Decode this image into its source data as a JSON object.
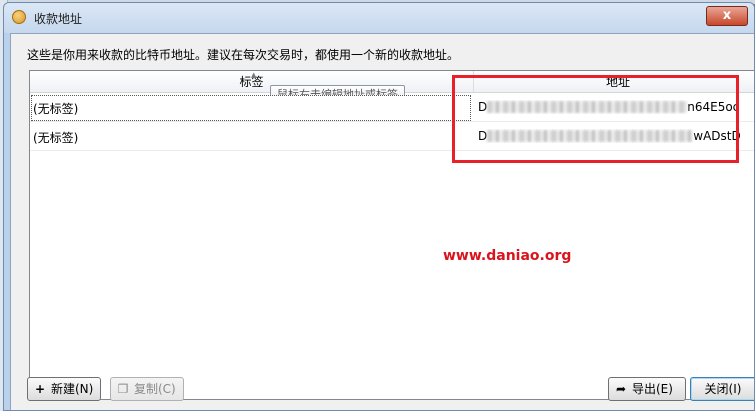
{
  "window": {
    "title": "收款地址",
    "close_glyph": "x"
  },
  "description": "这些是你用来收款的比特币地址。建议在每次交易时，都使用一个新的收款地址。",
  "table": {
    "columns": [
      "标签",
      "地址"
    ],
    "rows": [
      {
        "label": "(无标签)",
        "address_prefix": "D",
        "address_suffix": "n64E5oc"
      },
      {
        "label": "(无标签)",
        "address_prefix": "D",
        "address_suffix": "wADstD"
      }
    ]
  },
  "tooltip": "鼠标右击编辑地址或标签",
  "watermark": "www.daniao.org",
  "buttons": {
    "new": {
      "label": "新建(N)",
      "icon": "+"
    },
    "copy": {
      "label": "复制(C)",
      "icon": "❐"
    },
    "export": {
      "label": "导出(E)",
      "icon": "➦"
    },
    "close": {
      "label": "关闭(I)"
    }
  },
  "colors": {
    "highlight": "#e8202a",
    "watermark": "#d9141c"
  }
}
